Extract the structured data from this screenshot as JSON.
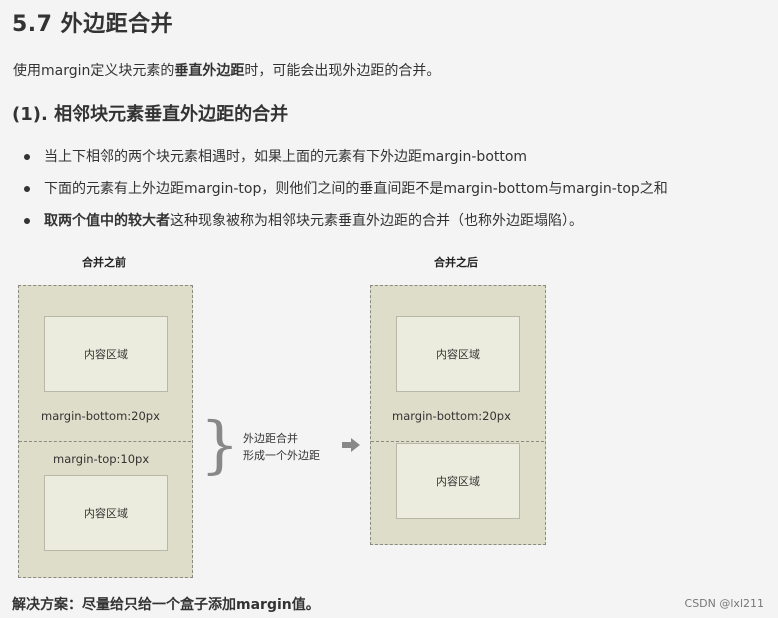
{
  "heading": "5.7 外边距合并",
  "intro": {
    "before": "使用margin定义块元素的",
    "bold": "垂直外边距",
    "after": "时，可能会出现外边距的合并。"
  },
  "subheading": "(1). 相邻块元素垂直外边距的合并",
  "bullets": {
    "b1": "当上下相邻的两个块元素相遇时，如果上面的元素有下外边距margin-bottom",
    "b2": "下面的元素有上外边距margin-top，则他们之间的垂直间距不是margin-bottom与margin-top之和",
    "b3_bold": "取两个值中的较大者",
    "b3_rest": "这种现象被称为相邻块元素垂直外边距的合并（也称外边距塌陷）。"
  },
  "diagram": {
    "before_caption": "合并之前",
    "after_caption": "合并之后",
    "content_area_label": "内容区域",
    "margin_bottom_label": "margin-bottom:20px",
    "margin_top_label": "margin-top:10px",
    "merge_note_line1": "外边距合并",
    "merge_note_line2": "形成一个外边距",
    "colors": {
      "outer_fill": "#deddc9",
      "inner_fill": "#ececde",
      "dashed_border": "#8a8a80"
    }
  },
  "solution": "解决方案：尽量给只给一个盒子添加margin值。",
  "watermark": "CSDN @lxl211"
}
